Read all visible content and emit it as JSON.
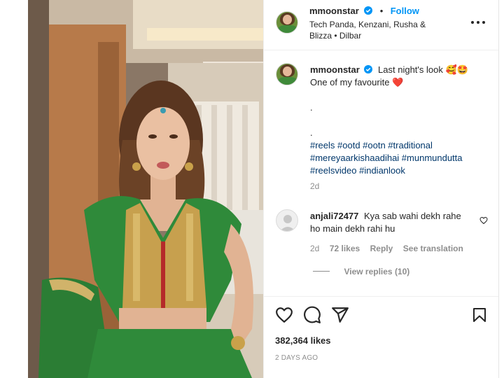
{
  "post": {
    "author": "mmoonstar",
    "follow_label": "Follow",
    "dot_separator": "•",
    "audio_line_1": "Tech Panda, Kenzani, Rusha &",
    "audio_line_2": "Blizza • Dilbar"
  },
  "caption": {
    "author": "mmoonstar",
    "line_1": "Last night's look 🥰🤩",
    "line_2": "One of my favourite ❤️",
    "dot_1": ".",
    "dot_2": ".",
    "hashtags_1": "#reels #ootd #ootn #traditional",
    "hashtags_2": "#mereyaarkishaadihai #munmundutta",
    "hashtags_3": "#reelsvideo #indianlook",
    "age": "2d"
  },
  "comment": {
    "username": "anjali72477",
    "text_1": "Kya sab wahi dekh rahe",
    "text_2": "ho main dekh rahi hu",
    "age": "2d",
    "likes": "72 likes",
    "reply_label": "Reply",
    "translate_label": "See translation",
    "view_replies": "View replies (10)"
  },
  "stats": {
    "likes": "382,364 likes",
    "posted": "2 DAYS AGO"
  },
  "icons": {
    "verified": "verified-badge-icon",
    "more": "more-options-icon",
    "like": "heart-icon",
    "comment": "comment-bubble-icon",
    "share": "paper-plane-icon",
    "save": "bookmark-icon",
    "comment_like": "small-heart-icon"
  },
  "colors": {
    "link_blue": "#0095f6",
    "hashtag_blue": "#00376b",
    "muted": "#8e8e8e",
    "text": "#262626",
    "heart_red": "#ed4956"
  }
}
